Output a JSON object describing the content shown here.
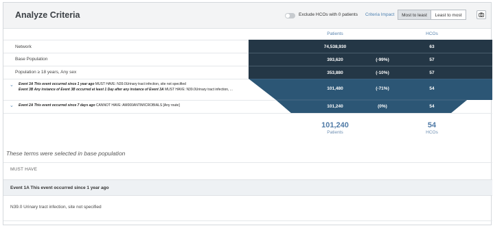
{
  "header": {
    "title": "Analyze Criteria",
    "exclude_label": "Exclude HCOs with 0 patients",
    "impact_label": "Criteria Impact",
    "most_to_least": "Most to least",
    "least_to_most": "Least to most"
  },
  "columns": {
    "patients": "Patients",
    "hcos": "HCOs"
  },
  "rows": [
    {
      "label": "Network",
      "patients": "74,538,930",
      "change": "",
      "hcos": "63"
    },
    {
      "label": "Base Population",
      "patients": "393,620",
      "change": "(-99%)",
      "hcos": "57"
    },
    {
      "label": "Population ≥ 18 years, Any sex",
      "patients": "353,880",
      "change": "(-10%)",
      "hcos": "57"
    }
  ],
  "events": [
    {
      "line1_bold": "Event 3A This event occurred since 1 year ago",
      "line1_rest": "  MUST HAVE: N39.0Urinary tract infection, site not specified",
      "line2_bold": "Event 3B Any instance of Event 3B occurred at least 1 Day after any instance of Event 3A",
      "line2_rest": "  MUST HAVE: N39.0Urinary tract infection, ...",
      "patients": "101,480",
      "change": "(-71%)",
      "hcos": "54"
    },
    {
      "line1_bold": "Event 2A This event occurred since 7 days ago",
      "line1_rest": " CANNOT HAVE: AM000ANTIMICROBIALS [Any route]",
      "patients": "101,240",
      "change": "(0%)",
      "hcos": "54"
    }
  ],
  "totals": {
    "patients": "101,240",
    "patients_label": "Patients",
    "hcos": "54",
    "hcos_label": "HCOs"
  },
  "terms_title": "These terms were selected in base population",
  "must_have": "MUST HAVE",
  "card": {
    "title": "Event 1A This event occurred since 1 year ago",
    "body": "N39.0  Urinary tract infection, site not specified"
  }
}
